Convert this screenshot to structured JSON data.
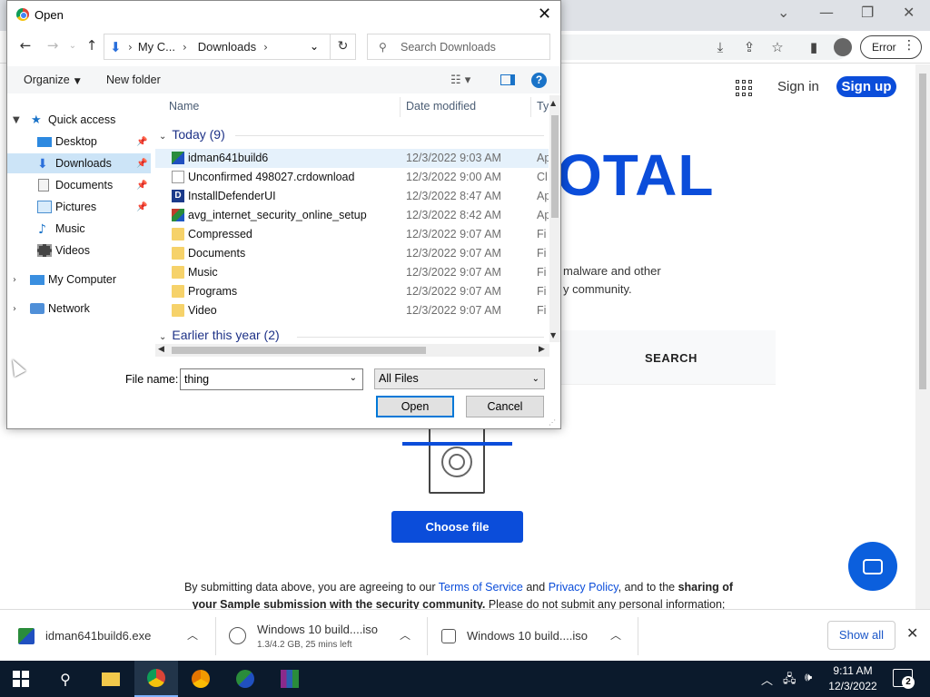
{
  "browser": {
    "error_chip_label": "Error",
    "sign_in": "Sign in",
    "sign_up": "Sign up",
    "brand_partial": "OTAL",
    "tagline_line1": "malware and other",
    "tagline_line2": "y community.",
    "search_tab": "SEARCH",
    "choose_file": "Choose file",
    "disclaimer": {
      "p1": "By submitting data above, you are agreeing to our ",
      "tos": "Terms of Service",
      "p2": " and ",
      "privacy": "Privacy Policy",
      "p3": ", and to the ",
      "bold1": "sharing of your Sample submission with the security community.",
      "p4": " Please do not submit any personal information;"
    },
    "accent_color": "#0b4dda"
  },
  "dialog": {
    "title": "Open",
    "address": {
      "crumbs": [
        "My C...",
        "Downloads"
      ]
    },
    "search_placeholder": "Search Downloads",
    "toolbar": {
      "organize": "Organize",
      "new_folder": "New folder"
    },
    "nav": [
      {
        "label": "Quick access",
        "icon": "star-icon"
      },
      {
        "label": "Desktop",
        "icon": "desktop-icon",
        "pinned": true
      },
      {
        "label": "Downloads",
        "icon": "download-icon",
        "pinned": true,
        "selected": true
      },
      {
        "label": "Documents",
        "icon": "documents-icon",
        "pinned": true
      },
      {
        "label": "Pictures",
        "icon": "pictures-icon",
        "pinned": true
      },
      {
        "label": "Music",
        "icon": "music-icon"
      },
      {
        "label": "Videos",
        "icon": "videos-icon"
      },
      {
        "label": "My Computer",
        "icon": "computer-icon"
      },
      {
        "label": "Network",
        "icon": "network-icon"
      }
    ],
    "columns": {
      "name": "Name",
      "date": "Date modified",
      "type": "Ty"
    },
    "groups": {
      "today": "Today (9)",
      "earlier": "Earlier this year (2)"
    },
    "files": [
      {
        "name": "idman641build6",
        "date": "12/3/2022 9:03 AM",
        "type": "Ap",
        "icon": "exe-icon"
      },
      {
        "name": "Unconfirmed 498027.crdownload",
        "date": "12/3/2022 9:00 AM",
        "type": "Cl",
        "icon": "file-icon"
      },
      {
        "name": "InstallDefenderUI",
        "date": "12/3/2022 8:47 AM",
        "type": "Ap",
        "icon": "defender-icon"
      },
      {
        "name": "avg_internet_security_online_setup",
        "date": "12/3/2022 8:42 AM",
        "type": "Ap",
        "icon": "avg-icon"
      },
      {
        "name": "Compressed",
        "date": "12/3/2022 9:07 AM",
        "type": "Fi",
        "icon": "folder-icon"
      },
      {
        "name": "Documents",
        "date": "12/3/2022 9:07 AM",
        "type": "Fi",
        "icon": "folder-icon"
      },
      {
        "name": "Music",
        "date": "12/3/2022 9:07 AM",
        "type": "Fi",
        "icon": "folder-icon"
      },
      {
        "name": "Programs",
        "date": "12/3/2022 9:07 AM",
        "type": "Fi",
        "icon": "folder-icon"
      },
      {
        "name": "Video",
        "date": "12/3/2022 9:07 AM",
        "type": "Fi",
        "icon": "folder-icon"
      }
    ],
    "file_name_label": "File name:",
    "file_name_value": "thing",
    "filter_value": "All Files",
    "open_label": "Open",
    "cancel_label": "Cancel"
  },
  "downloads": [
    {
      "name": "idman641build6.exe",
      "icon": "exe-icon"
    },
    {
      "name": "Windows 10 build....iso",
      "sub": "1.3/4.2 GB, 25 mins left",
      "icon": "iso-icon"
    },
    {
      "name": "Windows 10 build....iso",
      "icon": "iso-icon"
    }
  ],
  "show_all": "Show all",
  "taskbar": {
    "time": "9:11 AM",
    "date": "12/3/2022",
    "notification_count": "2"
  }
}
